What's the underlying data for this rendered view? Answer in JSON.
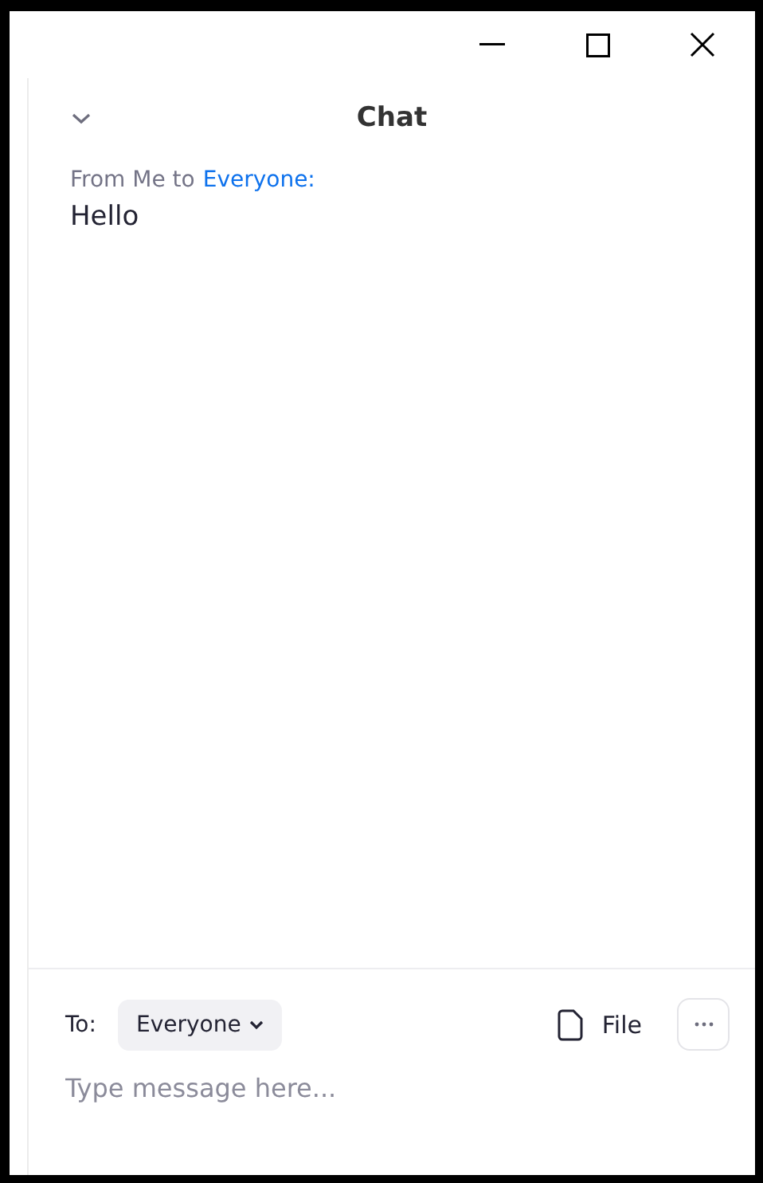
{
  "window": {
    "controls": [
      {
        "kind": "minimize"
      },
      {
        "kind": "maximize"
      },
      {
        "kind": "close"
      }
    ]
  },
  "chat": {
    "title": "Chat",
    "messages": [
      {
        "from": "From Me to",
        "to": "Everyone:",
        "text": "Hello"
      }
    ]
  },
  "composer": {
    "to_label": "To:",
    "recipient": "Everyone",
    "file_label": "File",
    "placeholder": "Type message here..."
  }
}
